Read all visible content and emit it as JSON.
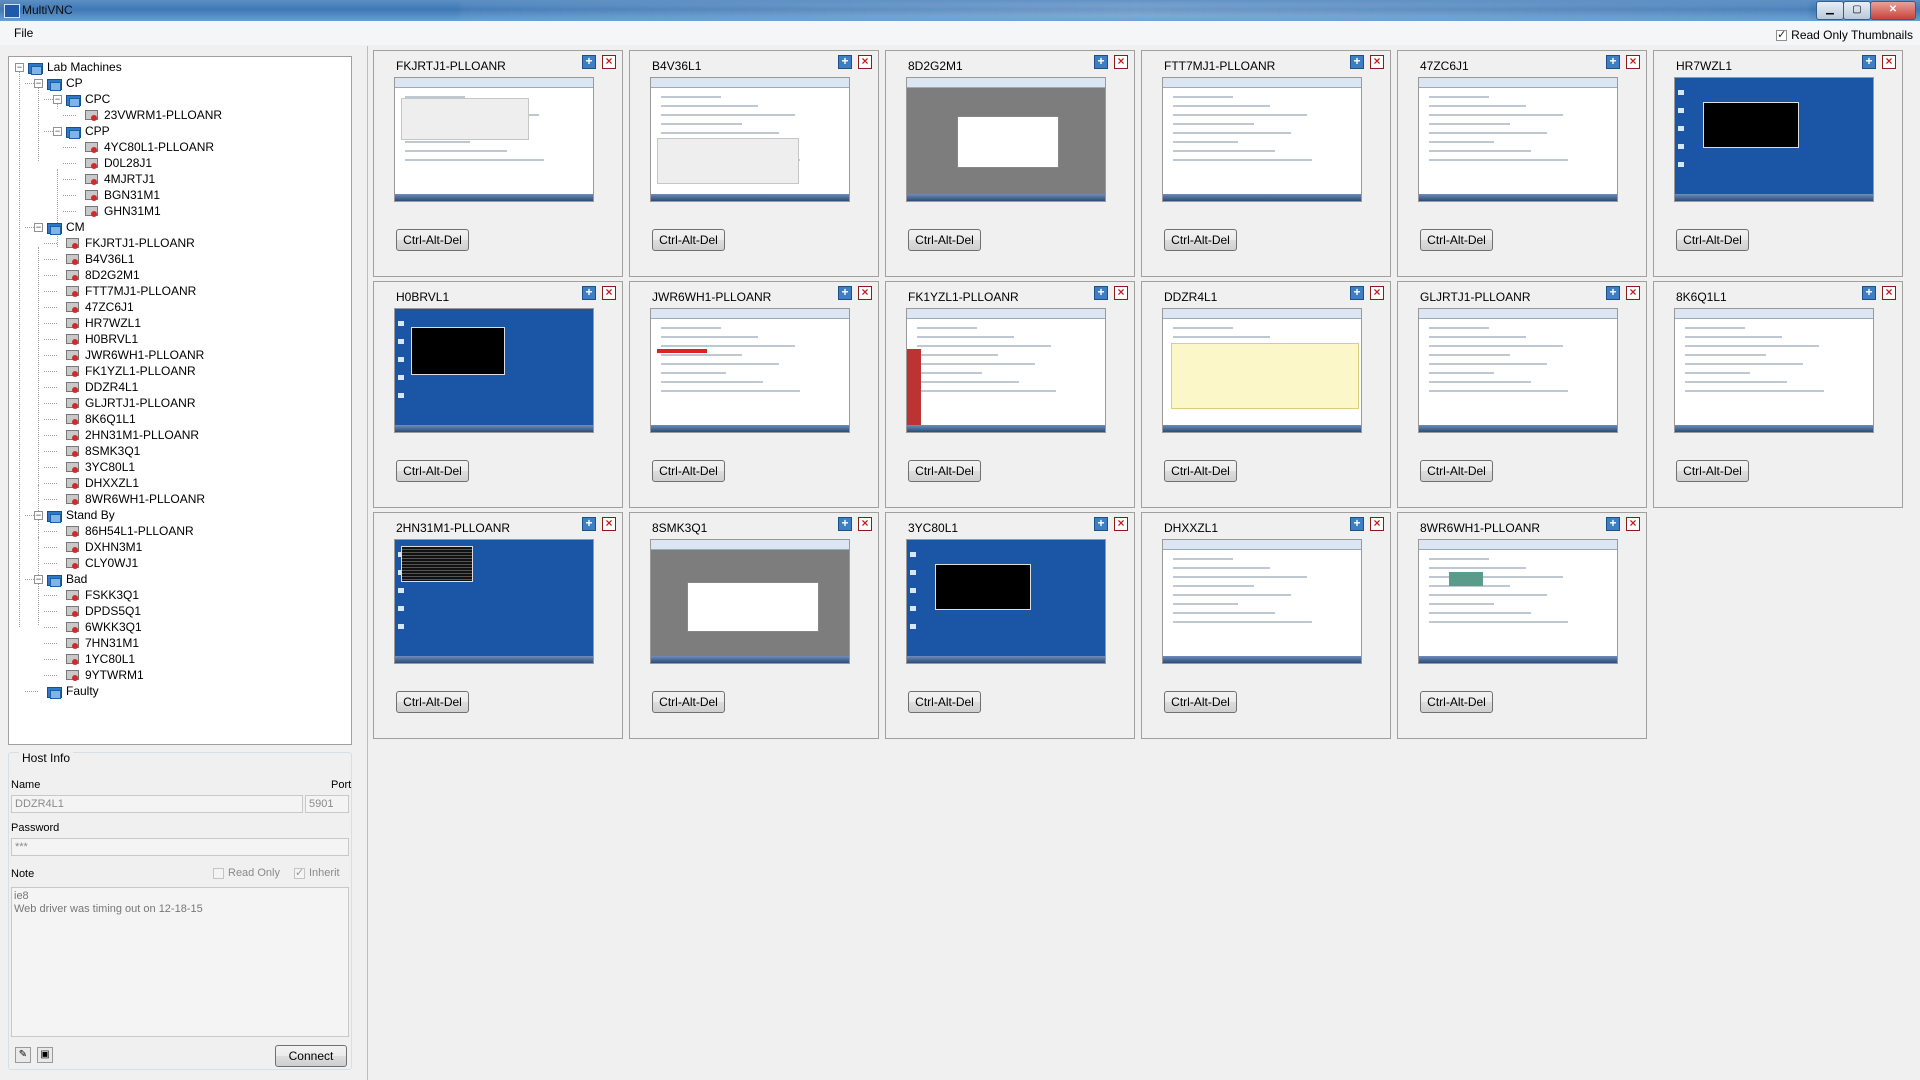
{
  "window": {
    "title": "MultiVNC"
  },
  "menu": {
    "file": "File"
  },
  "options": {
    "read_only_thumbnails": "Read Only Thumbnails",
    "read_only_thumbnails_checked": true
  },
  "tree": {
    "root": "Lab Machines",
    "cp": "CP",
    "cpc": "CPC",
    "cpc_hosts": [
      "23VWRM1-PLLOANR"
    ],
    "cpp": "CPP",
    "cpp_hosts": [
      "4YC80L1-PLLOANR",
      "D0L28J1",
      "4MJRTJ1",
      "BGN31M1",
      "GHN31M1"
    ],
    "cm": "CM",
    "cm_hosts": [
      "FKJRTJ1-PLLOANR",
      "B4V36L1",
      "8D2G2M1",
      "FTT7MJ1-PLLOANR",
      "47ZC6J1",
      "HR7WZL1",
      "H0BRVL1",
      "JWR6WH1-PLLOANR",
      "FK1YZL1-PLLOANR",
      "DDZR4L1",
      "GLJRTJ1-PLLOANR",
      "8K6Q1L1",
      "2HN31M1-PLLOANR",
      "8SMK3Q1",
      "3YC80L1",
      "DHXXZL1",
      "8WR6WH1-PLLOANR"
    ],
    "standby": "Stand By",
    "standby_hosts": [
      "86H54L1-PLLOANR",
      "DXHN3M1",
      "CLY0WJ1"
    ],
    "bad": "Bad",
    "bad_hosts": [
      "FSKK3Q1",
      "DPDS5Q1",
      "6WKK3Q1",
      "7HN31M1",
      "1YC80L1",
      "9YTWRM1"
    ],
    "faulty": "Faulty"
  },
  "host_info": {
    "title": "Host Info",
    "name_label": "Name",
    "port_label": "Port",
    "name_value": "DDZR4L1",
    "port_value": "5901",
    "password_label": "Password",
    "password_value": "***",
    "note_label": "Note",
    "read_only_label": "Read Only",
    "inherit_label": "Inherit",
    "note_line1": "ie8",
    "note_line2": "Web driver was timing out on 12-18-15",
    "connect_label": "Connect"
  },
  "thumbnails": [
    {
      "name": "FKJRTJ1-PLLOANR",
      "button": "Ctrl-Alt-Del"
    },
    {
      "name": "B4V36L1",
      "button": "Ctrl-Alt-Del"
    },
    {
      "name": "8D2G2M1",
      "button": "Ctrl-Alt-Del"
    },
    {
      "name": "FTT7MJ1-PLLOANR",
      "button": "Ctrl-Alt-Del"
    },
    {
      "name": "47ZC6J1",
      "button": "Ctrl-Alt-Del"
    },
    {
      "name": "HR7WZL1",
      "button": "Ctrl-Alt-Del"
    },
    {
      "name": "H0BRVL1",
      "button": "Ctrl-Alt-Del"
    },
    {
      "name": "JWR6WH1-PLLOANR",
      "button": "Ctrl-Alt-Del"
    },
    {
      "name": "FK1YZL1-PLLOANR",
      "button": "Ctrl-Alt-Del"
    },
    {
      "name": "DDZR4L1",
      "button": "Ctrl-Alt-Del"
    },
    {
      "name": "GLJRTJ1-PLLOANR",
      "button": "Ctrl-Alt-Del"
    },
    {
      "name": "8K6Q1L1",
      "button": "Ctrl-Alt-Del"
    },
    {
      "name": "2HN31M1-PLLOANR",
      "button": "Ctrl-Alt-Del"
    },
    {
      "name": "8SMK3Q1",
      "button": "Ctrl-Alt-Del"
    },
    {
      "name": "3YC80L1",
      "button": "Ctrl-Alt-Del"
    },
    {
      "name": "DHXXZL1",
      "button": "Ctrl-Alt-Del"
    },
    {
      "name": "8WR6WH1-PLLOANR",
      "button": "Ctrl-Alt-Del"
    }
  ]
}
